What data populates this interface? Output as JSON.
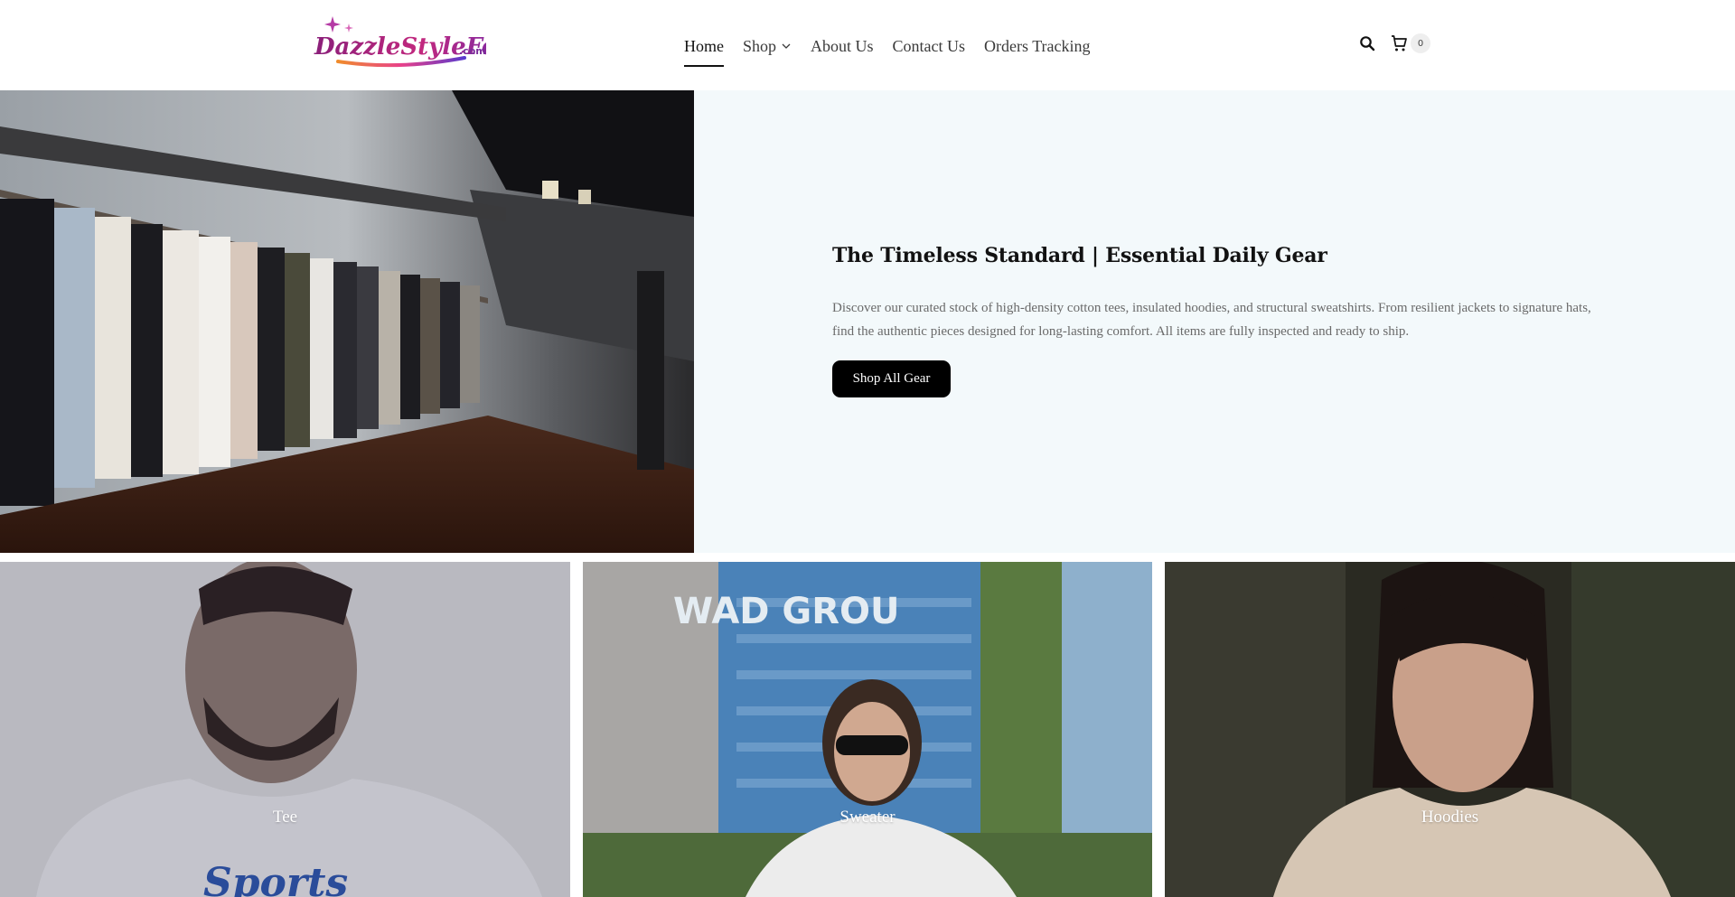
{
  "header": {
    "logo": {
      "text": "DazzleStyleFour",
      "suffix": ".com"
    },
    "nav": [
      {
        "label": "Home",
        "active": true
      },
      {
        "label": "Shop",
        "has_dropdown": true
      },
      {
        "label": "About Us"
      },
      {
        "label": "Contact Us"
      },
      {
        "label": "Orders Tracking"
      }
    ],
    "icons": {
      "search": "search-icon",
      "cart": "cart-icon"
    },
    "cart_count": "0"
  },
  "hero": {
    "title": "The Timeless Standard | Essential Daily Gear",
    "description": "Discover our curated stock of high-density cotton tees, insulated hoodies, and structural sweatshirts. From resilient jackets to signature hats, find the authentic pieces designed for long-lasting comfort. All items are fully inspected and ready to ship.",
    "button_label": "Shop All Gear"
  },
  "collections": [
    {
      "label": "Tee",
      "partial_text": "Sports"
    },
    {
      "label": "Sweater",
      "partial_text": "WAD GROU"
    },
    {
      "label": "Hoodies"
    }
  ],
  "colors": {
    "hero_bg": "#f3f9fb",
    "button_bg": "#000000",
    "text": "#121212",
    "muted": "#6a6a6a"
  }
}
